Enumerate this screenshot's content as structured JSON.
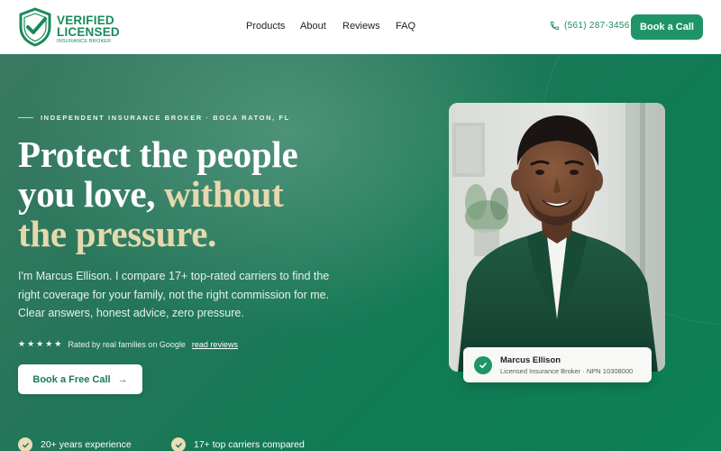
{
  "brand": {
    "line1": "VERIFIED",
    "line2": "LICENSED",
    "subline": "INSURANCE BROKER",
    "icon": "shield-check-icon",
    "color": "#1a8a5c"
  },
  "nav": {
    "items": [
      {
        "label": "Products"
      },
      {
        "label": "About"
      },
      {
        "label": "Reviews"
      },
      {
        "label": "FAQ"
      }
    ]
  },
  "header": {
    "phone": "(561) 287-3456",
    "phone_icon": "phone-icon",
    "cta_label": "Book a Call",
    "accent": "#1f9468"
  },
  "hero": {
    "eyebrow": "INDEPENDENT INSURANCE BROKER · BOCA RATON, FL",
    "headline": {
      "line1": "Protect the people",
      "line2_main": "you love, ",
      "line2_accent": "without",
      "line3_accent": "the pressure."
    },
    "lead": [
      "I'm Marcus Ellison. I compare 17+ top-rated carriers to find the",
      "right coverage for your family, not the right commission for me.",
      "Clear answers, honest advice, zero pressure."
    ],
    "rating": {
      "stars": "★★★★★",
      "text": "Rated by real families on Google",
      "link": "read reviews"
    },
    "cta_label": "Book a Free Call",
    "cta_arrow": "→",
    "features": [
      {
        "text": "20+ years experience"
      },
      {
        "text": "17+ top carriers compared"
      }
    ],
    "accent_gold": "#e6d8ae"
  },
  "profile": {
    "name": "Marcus Ellison",
    "role": "Licensed Insurance Broker · NPN 10308000"
  }
}
